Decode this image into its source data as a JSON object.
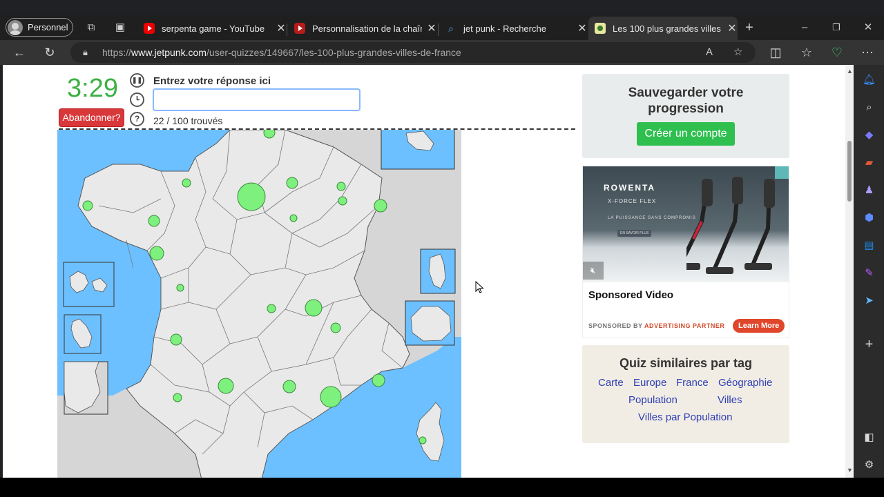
{
  "browser": {
    "profile_label": "Personnel",
    "tabs": [
      {
        "label": "serpenta game - YouTube",
        "favicon": "youtube-icon"
      },
      {
        "label": "Personnalisation de la chaîne",
        "favicon": "youtube-studio-icon"
      },
      {
        "label": "jet punk - Recherche",
        "favicon": "search-icon"
      },
      {
        "label": "Les 100 plus grandes villes de",
        "favicon": "jetpunk-icon"
      }
    ],
    "new_tab_label": "+",
    "url_prefix": "https://",
    "url_host": "www.jetpunk.com",
    "url_path": "/user-quizzes/149667/les-100-plus-grandes-villes-de-france"
  },
  "quiz": {
    "timer": "3:29",
    "give_up_label": "Abandonner?",
    "prompt": "Entrez votre réponse ici",
    "answer_value": "",
    "found_text": "22 / 100 trouvés",
    "help_glyph": "?",
    "colors": {
      "timer": "#3cb043",
      "give_up": "#d9383a",
      "found_marker": "#7ef07e",
      "sea": "#6cc0ff"
    }
  },
  "save_card": {
    "title": "Sauvegarder votre progression",
    "button_label": "Créer un compte"
  },
  "ad": {
    "brand": "ROWENTA",
    "model": "X-FORCE FLEX",
    "tagline": "LA PUISSANCE SANS COMPROMIS",
    "small_cta": "EN SAVOIR PLUS",
    "title": "Sponsored Video",
    "sponsored_by": "SPONSORED BY",
    "sponsor_name": "ADVERTISING PARTNER",
    "learn_more": "Learn More"
  },
  "similar": {
    "title": "Quiz similaires par tag",
    "tags": [
      "Carte",
      "Europe",
      "France",
      "Géographie",
      "Population",
      "Villes",
      "Villes par Population"
    ]
  }
}
